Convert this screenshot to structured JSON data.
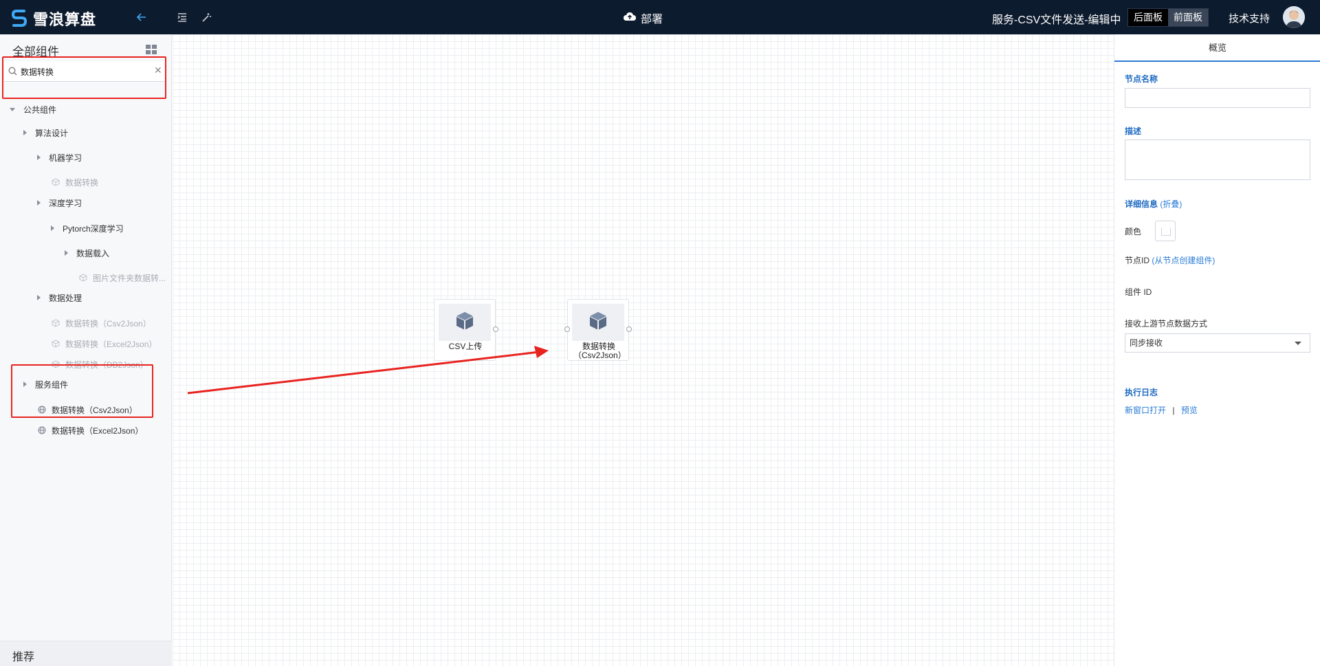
{
  "header": {
    "brand": "雪浪算盘",
    "deploy_label": "部署",
    "project_title": "服务-CSV文件发送-编辑中",
    "toggle_back": "后面板",
    "toggle_front": "前面板",
    "support": "技术支持",
    "icons": [
      "back-arrow-icon",
      "outline-list-icon",
      "magic-wand-icon",
      "cloud-upload-icon"
    ]
  },
  "sidebar": {
    "title": "全部组件",
    "search": {
      "value": "数据转换",
      "placeholder": ""
    },
    "tree": {
      "public": "公共组件",
      "algo": "算法设计",
      "ml": "机器学习",
      "ml_convert": "数据转换",
      "dl": "深度学习",
      "pytorch": "Pytorch深度学习",
      "data_load": "数据载入",
      "img_folder": "图片文件夹数据转...",
      "data_proc": "数据处理",
      "conv_csv": "数据转换（Csv2Json）",
      "conv_excel": "数据转换（Excel2Json）",
      "conv_db": "数据转换（DB2Json）",
      "service": "服务组件",
      "svc_csv": "数据转换（Csv2Json）",
      "svc_excel": "数据转换（Excel2Json）"
    },
    "recommend": "推荐"
  },
  "canvas": {
    "nodes": [
      {
        "label": "CSV上传"
      },
      {
        "label": "数据转换（Csv2Json）"
      }
    ]
  },
  "panel": {
    "tab": "概览",
    "node_name_label": "节点名称",
    "node_name_value": "",
    "desc_label": "描述",
    "desc_value": "",
    "detail_label": "详细信息",
    "detail_fold": "(折叠)",
    "color_label": "颜色",
    "node_id_label": "节点ID",
    "node_id_link": "(从节点创建组件)",
    "comp_id_label": "组件 ID",
    "receive_label": "接收上游节点数据方式",
    "receive_value": "同步接收",
    "log_label": "执行日志",
    "log_open": "新窗口打开",
    "log_sep": "|",
    "log_preview": "预览"
  },
  "colors": {
    "header_bg": "#0d1b2e",
    "accent": "#2a7bd5",
    "highlight": "#e8231f"
  }
}
